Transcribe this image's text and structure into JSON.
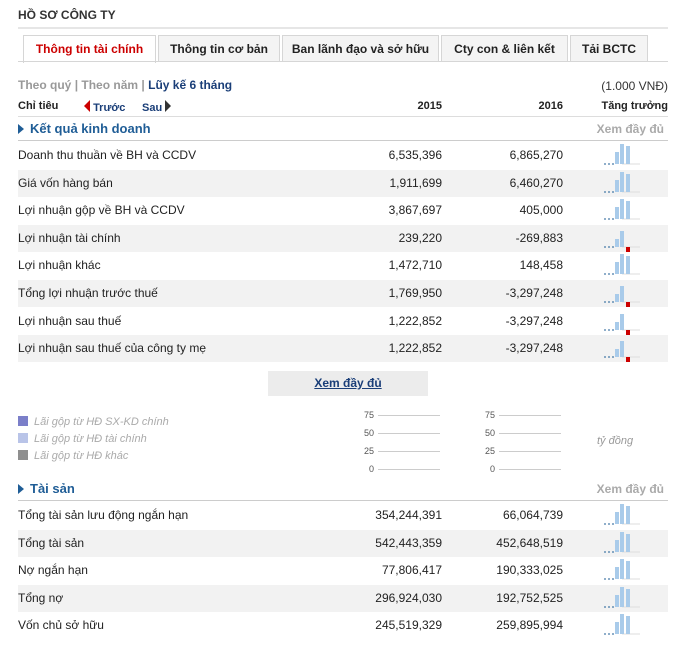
{
  "page": {
    "title": "HỒ SƠ CÔNG TY"
  },
  "tabs": [
    "Thông tin tài chính",
    "Thông tin cơ bản",
    "Ban lãnh đạo và sở hữu",
    "Cty con & liên kết",
    "Tải BCTC"
  ],
  "periods": {
    "quarter": "Theo quý",
    "year": "Theo năm",
    "cumulative": "Lũy kế 6 tháng",
    "unit": "(1.000 VNĐ)"
  },
  "header": {
    "item": "Chỉ tiêu",
    "prev": "Trước",
    "next": "Sau",
    "col1": "2015",
    "col2": "2016",
    "growth": "Tăng trưởng"
  },
  "section1": {
    "name": "Kết quả kinh doanh",
    "more": "Xem đầy đủ"
  },
  "section1_rows": [
    {
      "label": "Doanh thu thuần về BH và CCDV",
      "v2015": "6,535,396",
      "v2016": "6,865,270",
      "spark": "up"
    },
    {
      "label": "Giá vốn hàng bán",
      "v2015": "1,911,699",
      "v2016": "6,460,270",
      "spark": "up"
    },
    {
      "label": "Lợi nhuận gộp về BH và CCDV",
      "v2015": "3,867,697",
      "v2016": "405,000",
      "spark": "up"
    },
    {
      "label": "Lợi nhuận tài chính",
      "v2015": "239,220",
      "v2016": "-269,883",
      "spark": "down"
    },
    {
      "label": "Lợi nhuận khác",
      "v2015": "1,472,710",
      "v2016": "148,458",
      "spark": "up"
    },
    {
      "label": "Tổng lợi nhuận trước thuế",
      "v2015": "1,769,950",
      "v2016": "-3,297,248",
      "spark": "down"
    },
    {
      "label": "Lợi nhuận sau thuế",
      "v2015": "1,222,852",
      "v2016": "-3,297,248",
      "spark": "down"
    },
    {
      "label": "Lợi nhuận sau thuế của công ty mẹ",
      "v2015": "1,222,852",
      "v2016": "-3,297,248",
      "spark": "down"
    }
  ],
  "more_button": "Xem đầy đủ",
  "legend": [
    {
      "label": "Lãi gộp từ HĐ SX-KD chính",
      "color": "#7b7fc9"
    },
    {
      "label": "Lãi gộp từ HĐ tài chính",
      "color": "#b9c4e8"
    },
    {
      "label": "Lãi gộp từ HĐ khác",
      "color": "#8f8f8f"
    }
  ],
  "axis_ticks": [
    "75",
    "50",
    "25",
    "0"
  ],
  "unit_label": "tỷ đồng",
  "section2": {
    "name": "Tài sản",
    "more": "Xem đầy đủ"
  },
  "section2_rows": [
    {
      "label": "Tổng tài sản lưu động ngắn hạn",
      "v2015": "354,244,391",
      "v2016": "66,064,739",
      "spark": "up"
    },
    {
      "label": "Tổng tài sản",
      "v2015": "542,443,359",
      "v2016": "452,648,519",
      "spark": "up"
    },
    {
      "label": "Nợ ngắn hạn",
      "v2015": "77,806,417",
      "v2016": "190,333,025",
      "spark": "up"
    },
    {
      "label": "Tổng nợ",
      "v2015": "296,924,030",
      "v2016": "192,752,525",
      "spark": "up"
    },
    {
      "label": "Vốn chủ sở hữu",
      "v2015": "245,519,329",
      "v2016": "259,895,994",
      "spark": "up"
    }
  ],
  "colors": {
    "accent": "#c00000",
    "section": "#1f5d96",
    "bar_pos": "#a9cbea",
    "bar_neg": "#cc0000"
  }
}
